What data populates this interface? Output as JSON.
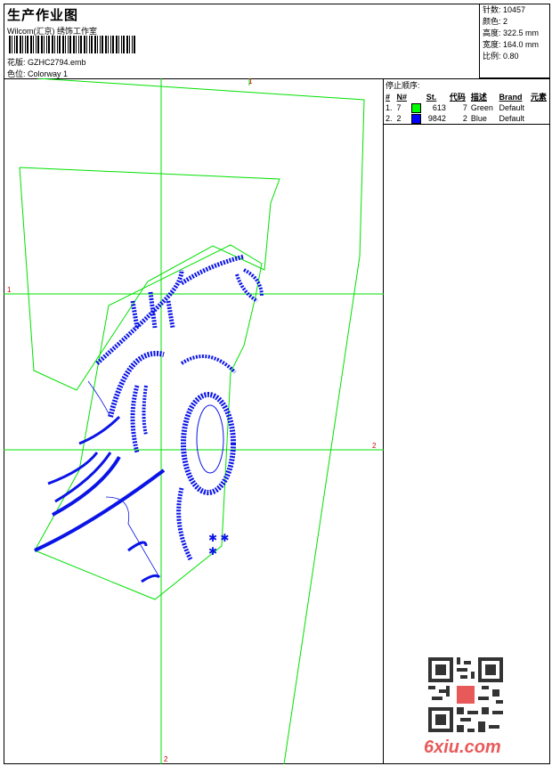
{
  "header": {
    "title": "生产作业图",
    "studio": "Wilcom(汇京) 绣饰工作室",
    "design_label": "花版:",
    "design_value": "GZHC2794.emb",
    "colorway_label": "色位:",
    "colorway_value": "Colorway 1"
  },
  "stats": [
    {
      "label": "针数:",
      "value": "10457"
    },
    {
      "label": "颜色:",
      "value": "2"
    },
    {
      "label": "高度:",
      "value": "322.5 mm"
    },
    {
      "label": "宽度:",
      "value": "164.0 mm"
    },
    {
      "label": "比例:",
      "value": "0.80"
    }
  ],
  "stop_sequence": {
    "caption": "停止顺序:",
    "columns": [
      "#",
      "N#",
      "",
      "St.",
      "代码",
      "描述",
      "Brand",
      "元素"
    ],
    "rows": [
      {
        "idx": "1.",
        "n": "7",
        "color": "#00ff00",
        "st": "613",
        "code": "7",
        "desc": "Green",
        "brand": "Default"
      },
      {
        "idx": "2.",
        "n": "2",
        "color": "#0000ff",
        "st": "9842",
        "code": "2",
        "desc": "Blue",
        "brand": "Default"
      }
    ]
  },
  "guides": {
    "top": "1",
    "left": "1",
    "right": "2",
    "bottom": "2"
  },
  "colors": {
    "outline": "#00e000",
    "stitch": "#0a14e6",
    "guide_label": "#cc0000"
  },
  "watermark": "6xiu.com"
}
